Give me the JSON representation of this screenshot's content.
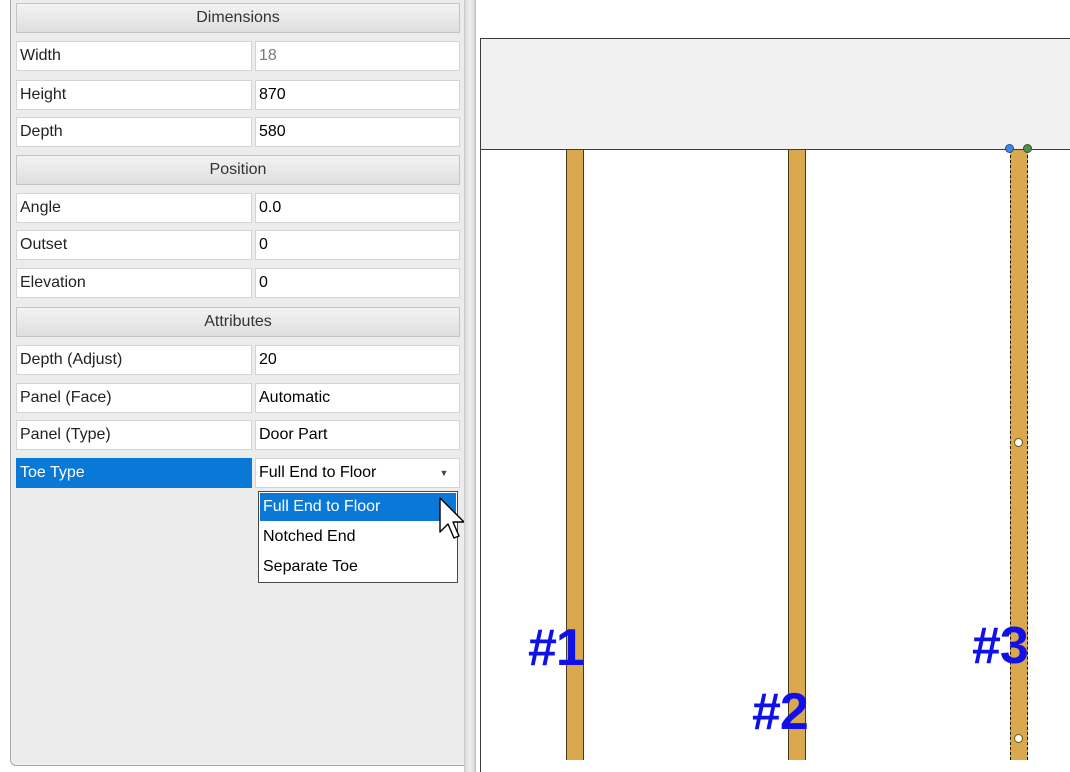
{
  "panel": {
    "sections": [
      {
        "title": "Dimensions"
      },
      {
        "title": "Position"
      },
      {
        "title": "Attributes"
      }
    ],
    "rows": [
      {
        "label": "Width",
        "value": "18"
      },
      {
        "label": "Height",
        "value": "870"
      },
      {
        "label": "Depth",
        "value": "580"
      },
      {
        "label": "Angle",
        "value": "0.0"
      },
      {
        "label": "Outset",
        "value": "0"
      },
      {
        "label": "Elevation",
        "value": "0"
      },
      {
        "label": "Depth (Adjust)",
        "value": "20"
      },
      {
        "label": "Panel (Face)",
        "value": "Automatic"
      },
      {
        "label": "Panel (Type)",
        "value": "Door Part"
      },
      {
        "label": "Toe Type",
        "value": "Full End to Floor"
      }
    ],
    "dropdown": {
      "options": [
        "Full End to Floor",
        "Notched End",
        "Separate Toe"
      ],
      "highlighted": "Full End to Floor"
    }
  },
  "canvas": {
    "tags": [
      "#1",
      "#2",
      "#3"
    ]
  },
  "colors": {
    "selection": "#0a78d7",
    "stile": "#d9a84f",
    "tag": "#1010e8"
  }
}
